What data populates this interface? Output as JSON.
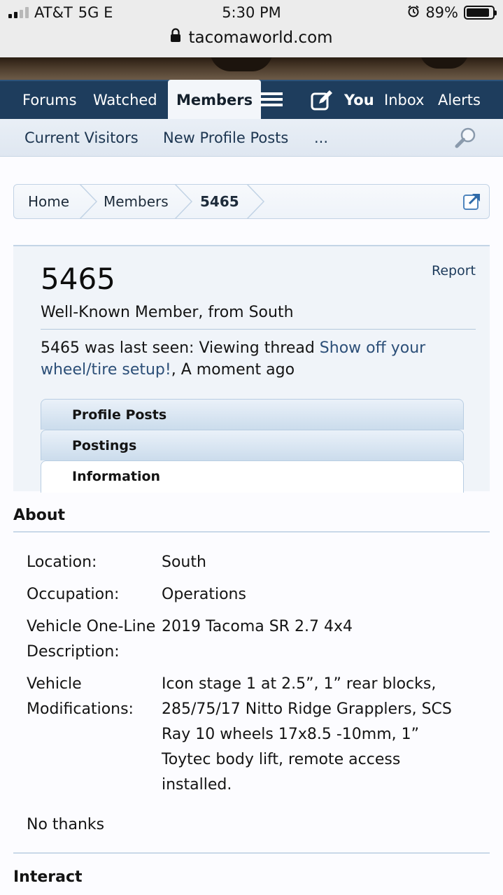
{
  "status_bar": {
    "carrier": "AT&T",
    "network": "5G E",
    "time": "5:30 PM",
    "battery": "89%",
    "battery_level": 0.89
  },
  "url": "tacomaworld.com",
  "nav": {
    "items": [
      "Forums",
      "Watched",
      "Members"
    ],
    "you": "You",
    "inbox": "Inbox",
    "alerts": "Alerts"
  },
  "subnav": {
    "items": [
      "Current Visitors",
      "New Profile Posts",
      "..."
    ]
  },
  "breadcrumb": [
    "Home",
    "Members",
    "5465"
  ],
  "profile": {
    "username": "5465",
    "report": "Report",
    "subtitle": "Well-Known Member, from South",
    "last_seen_prefix": "5465 was last seen: Viewing thread ",
    "last_seen_link": "Show off your wheel/tire setup!",
    "last_seen_suffix": ", A moment ago"
  },
  "tabs": [
    "Profile Posts",
    "Postings",
    "Information"
  ],
  "about": {
    "heading": "About",
    "rows": [
      {
        "label": "Location:",
        "value": "South"
      },
      {
        "label": "Occupation:",
        "value": "Operations"
      },
      {
        "label": "Vehicle One-Line Description:",
        "value": "2019 Tacoma SR 2.7 4x4"
      },
      {
        "label": "Vehicle Modifications:",
        "value": "Icon stage 1 at 2.5”, 1” rear blocks, 285/75/17 Nitto Ridge Grapplers, SCS Ray 10 wheels 17x8.5 -10mm, 1” Toytec body lift, remote access installed."
      }
    ],
    "footer_text": "No thanks"
  },
  "interact": {
    "heading": "Interact"
  }
}
